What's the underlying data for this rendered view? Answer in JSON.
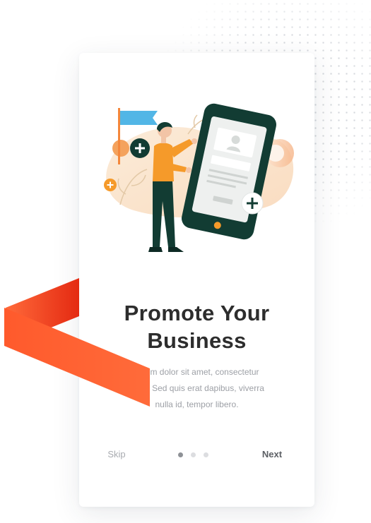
{
  "onboarding": {
    "title_line1": "Promote Your",
    "title_line2": "Business",
    "description_lines": [
      "ipsum dolor sit amet, consectetur",
      "g elit. Sed quis erat dapibus, viverra",
      "nulla id, tempor libero."
    ],
    "skip_label": "Skip",
    "next_label": "Next",
    "pager": {
      "total": 3,
      "active_index": 0
    }
  },
  "colors": {
    "accent_orange": "#ff5a2c",
    "figure_green": "#123c33",
    "flag_blue": "#52b6e6",
    "shirt_orange": "#f59a2a",
    "title_text": "#2d2d2d"
  },
  "icons": [
    "flag-icon",
    "plus-icon",
    "smartphone-icon",
    "user-avatar-icon",
    "leaf-icon"
  ]
}
